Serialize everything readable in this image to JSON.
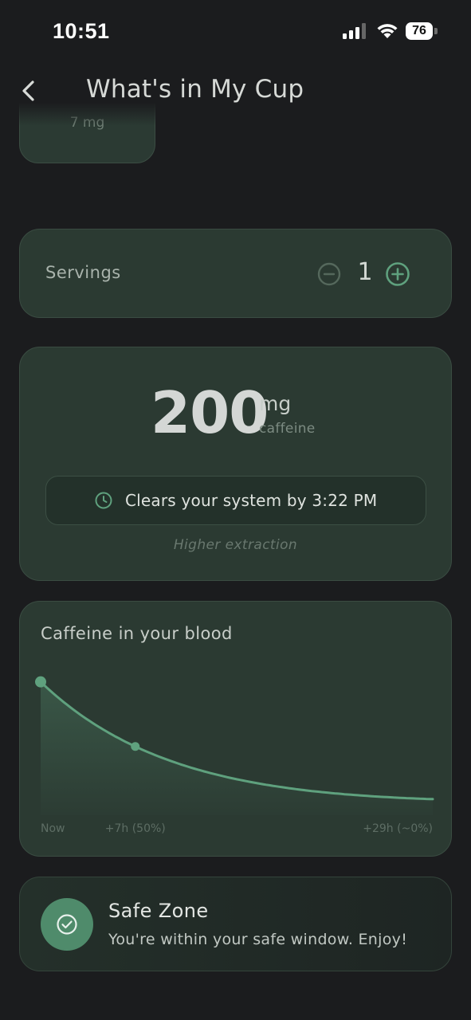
{
  "status_bar": {
    "time": "10:51",
    "battery": "76",
    "icons": [
      "signal-icon",
      "wifi-icon",
      "battery-icon"
    ]
  },
  "header": {
    "title": "What's in My Cup",
    "back_icon": "chevron-left-icon"
  },
  "previous_card": {
    "partial_text": "7 mg"
  },
  "servings": {
    "label": "Servings",
    "count": "1",
    "minus_icon": "minus-circle-icon",
    "plus_icon": "plus-circle-icon"
  },
  "caffeine": {
    "amount": "200",
    "unit": "mg",
    "sub_label": "caffeine",
    "clears_icon": "clock-icon",
    "clears_text": "Clears your system by 3:22 PM",
    "note": "Higher extraction"
  },
  "blood_chart": {
    "title": "Caffeine in your blood"
  },
  "chart_data": {
    "type": "line",
    "title": "Caffeine in your blood",
    "x_tick_labels": [
      "Now",
      "+7h (50%)",
      "+29h (~0%)"
    ],
    "x": [
      0,
      7,
      29
    ],
    "y": [
      100,
      50,
      6
    ],
    "highlighted_points": [
      0,
      7
    ],
    "grid": false,
    "area_fill": true
  },
  "safe_zone": {
    "title": "Safe Zone",
    "message": "You're within your safe window. Enjoy!",
    "icon": "check-circle-icon"
  },
  "colors": {
    "background": "#1b1c1e",
    "card": "#2b3a32",
    "accent": "#5fa17e",
    "safe_icon_bg": "#4f8b6b"
  }
}
